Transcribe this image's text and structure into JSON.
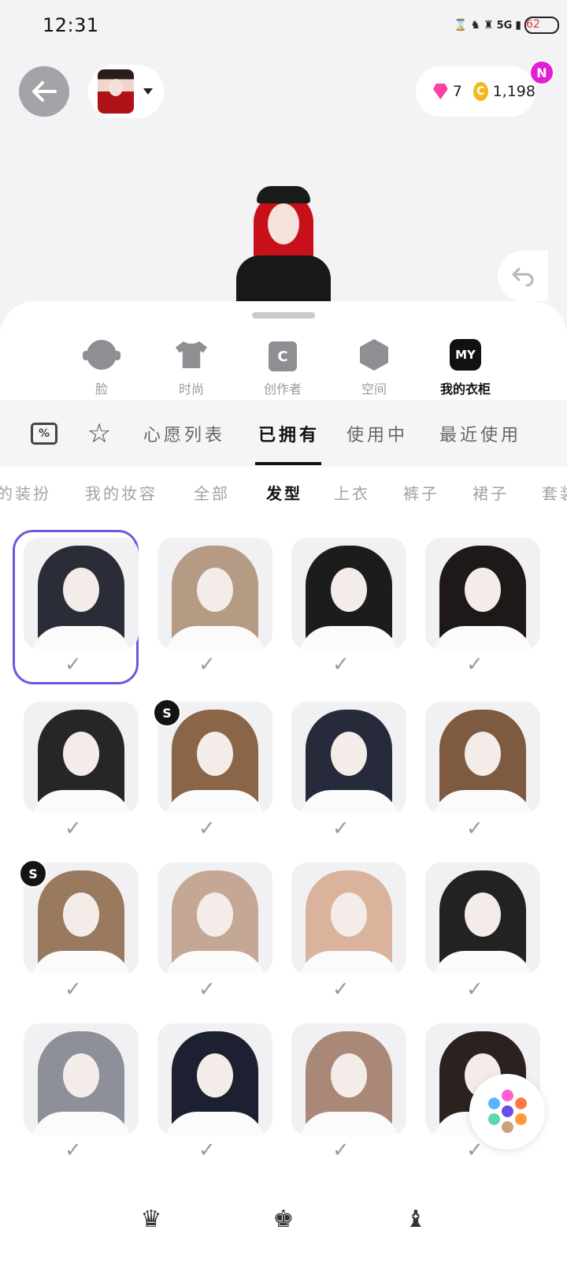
{
  "status_bar": {
    "time": "12:31",
    "network": "5G",
    "battery": "62"
  },
  "header": {
    "gems": "7",
    "coins": "1,198",
    "notification_badge": "N",
    "back_icon": "arrow-left-icon",
    "undo_icon": "undo-arrow-icon"
  },
  "categories": [
    {
      "label": "脸",
      "icon": "face-icon"
    },
    {
      "label": "时尚",
      "icon": "shirt-icon"
    },
    {
      "label": "创作者",
      "icon": "creator-bag-icon",
      "glyph": "C"
    },
    {
      "label": "空间",
      "icon": "space-cube-icon"
    },
    {
      "label": "我的衣柜",
      "icon": "my-closet-icon",
      "glyph": "MY",
      "active": true
    }
  ],
  "tabs": {
    "coupon_glyph": "%",
    "items": [
      {
        "label": "心愿列表"
      },
      {
        "label": "已拥有",
        "active": true
      },
      {
        "label": "使用中"
      },
      {
        "label": "最近使用"
      }
    ]
  },
  "subcategories": [
    {
      "label": "的装扮"
    },
    {
      "label": "我的妆容"
    },
    {
      "label": "全部"
    },
    {
      "label": "发型",
      "active": true
    },
    {
      "label": "上衣"
    },
    {
      "label": "裤子"
    },
    {
      "label": "裙子"
    },
    {
      "label": "套装"
    }
  ],
  "grid": {
    "check_glyph": "✓",
    "s_badge": "S",
    "items": [
      {
        "color": "#2a2d38",
        "selected": true
      },
      {
        "color": "#b59a84"
      },
      {
        "color": "#1c1c1c"
      },
      {
        "color": "#1e1818"
      },
      {
        "color": "#262626"
      },
      {
        "color": "#8a6547",
        "badge": true
      },
      {
        "color": "#262a3a"
      },
      {
        "color": "#7d5a40"
      },
      {
        "color": "#9a7a5e",
        "badge": true
      },
      {
        "color": "#c4a895"
      },
      {
        "color": "#d9b39c"
      },
      {
        "color": "#222222"
      },
      {
        "color": "#8d9099"
      },
      {
        "color": "#1d2030"
      },
      {
        "color": "#a98878"
      },
      {
        "color": "#2b2220"
      }
    ]
  },
  "color_fab": {
    "icon": "color-palette-icon",
    "colors": [
      "#ff5fd0",
      "#ff7a45",
      "#5ab3ff",
      "#6a4de8",
      "#ff9a3c",
      "#5ed6b0",
      "#c9a27a"
    ]
  },
  "bottom_nav": [
    {
      "icon": "character-icon-1"
    },
    {
      "icon": "character-icon-2"
    },
    {
      "icon": "character-icon-3"
    }
  ]
}
